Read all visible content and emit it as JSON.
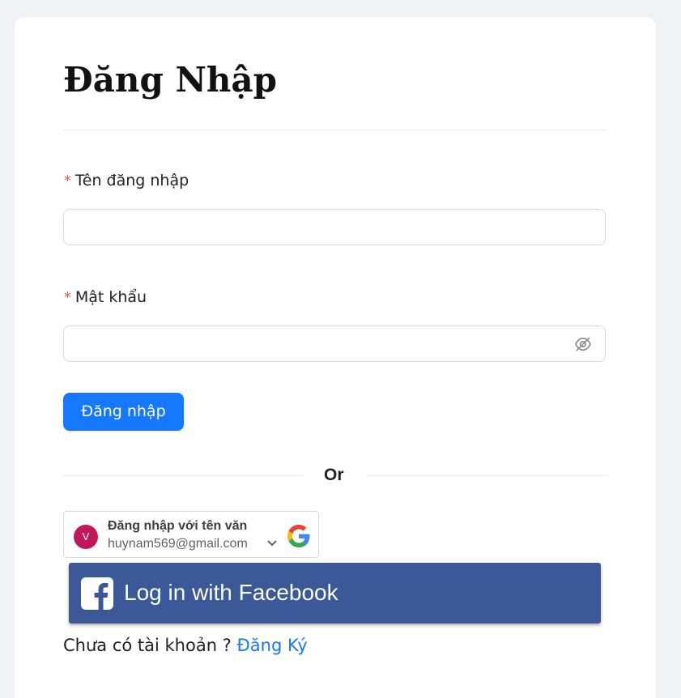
{
  "login": {
    "title": "Đăng Nhập",
    "username": {
      "required_mark": "*",
      "label": "Tên đăng nhập",
      "value": "",
      "placeholder": ""
    },
    "password": {
      "required_mark": "*",
      "label": "Mật khẩu",
      "value": "",
      "placeholder": "",
      "toggle_icon": "eye-invisible-icon"
    },
    "submit_label": "Đăng nhập",
    "divider_text": "Or",
    "google": {
      "avatar_initial": "V",
      "signin_text": "Đăng nhập với tên văn",
      "email": "huynam569@gmail.com",
      "icon": "google-icon"
    },
    "facebook": {
      "label": "Log in with Facebook",
      "icon": "facebook-icon"
    },
    "footer": {
      "question": "Chưa có tài khoản ?",
      "register_link": "Đăng Ký"
    }
  },
  "colors": {
    "page_background": "#eff2f7",
    "primary": "#1677ff",
    "required": "#ff4d4f",
    "facebook": "#3b5998"
  }
}
